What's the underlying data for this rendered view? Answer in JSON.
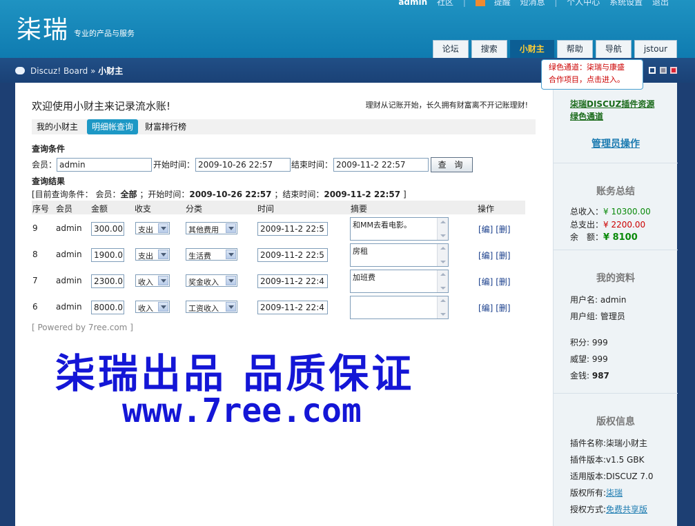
{
  "header": {
    "toplinks": [
      "admin",
      "社区",
      "提醒",
      "短消息",
      "个人中心",
      "系统设置",
      "退出"
    ],
    "logo": "柒瑞",
    "slogan": "专业的产品与服务",
    "nav": [
      "论坛",
      "搜索",
      "小财主",
      "帮助",
      "导航",
      "jstour"
    ]
  },
  "breadcrumb": {
    "site": "Discuz! Board",
    "sep": "»",
    "current": "小财主"
  },
  "bubble": {
    "line1": "绿色通道：柒瑞与康盛",
    "line2": "合作项目，点击进入。"
  },
  "main": {
    "welcome": "欢迎使用小财主来记录流水账!",
    "motto": "理财从记账开始，长久拥有财富离不开记账理财!",
    "tabs": [
      "我的小财主",
      "明细帐查询",
      "财富排行榜"
    ],
    "query": {
      "title": "查询条件",
      "member_label": "会员：",
      "member_value": "admin",
      "start_label": "开始时间：",
      "start_value": "2009-10-26 22:57",
      "end_label": "结束时间：",
      "end_value": "2009-11-2 22:57",
      "button": "查 询"
    },
    "result": {
      "title": "查询结果",
      "cond_prefix": "[目前查询条件： 会员：",
      "cond_member": "全部",
      "cond_start_label": "；开始时间：",
      "cond_start": "2009-10-26 22:57",
      "cond_end_label": "；结束时间：",
      "cond_end": "2009-11-2 22:57",
      "cond_suffix": "]"
    },
    "columns": [
      "序号",
      "会员",
      "金额",
      "收支",
      "分类",
      "时间",
      "摘要",
      "操作"
    ],
    "rows": [
      {
        "no": "9",
        "member": "admin",
        "amount": "300.00",
        "io": "支出",
        "cat": "其他费用",
        "time": "2009-11-2 22:5",
        "memo": "和MM去看电影。",
        "edit": "[编]",
        "del": "[删]"
      },
      {
        "no": "8",
        "member": "admin",
        "amount": "1900.0",
        "io": "支出",
        "cat": "生活费",
        "time": "2009-11-2 22:5",
        "memo": "房租",
        "edit": "[编]",
        "del": "[删]"
      },
      {
        "no": "7",
        "member": "admin",
        "amount": "2300.0",
        "io": "收入",
        "cat": "奖金收入",
        "time": "2009-11-2 22:4",
        "memo": "加班费",
        "edit": "[编]",
        "del": "[删]"
      },
      {
        "no": "6",
        "member": "admin",
        "amount": "8000.0",
        "io": "收入",
        "cat": "工资收入",
        "time": "2009-11-2 22:4",
        "memo": "",
        "edit": "[编]",
        "del": "[删]"
      }
    ],
    "powered": "[ Powered by 7ree.com ]",
    "promo1": "柒瑞出品  品质保证",
    "promo2": "www.7ree.com"
  },
  "sidebar": {
    "link_line1": "柒瑞DISCUZ插件资源",
    "link_line2": "绿色通道",
    "admin_ops": "管理员操作",
    "summary": {
      "title": "账务总结",
      "income_label": "总收入：",
      "income_value": "¥ 10300.00",
      "expense_label": "总支出：",
      "expense_value": "¥ 2200.00",
      "balance_label": "余　额：",
      "balance_value": "¥ 8100"
    },
    "profile": {
      "title": "我的资料",
      "username": "用户名: admin",
      "group": "用户组: 管理员",
      "points": "积分: 999",
      "prestige": "威望: 999",
      "money_label": "金钱: ",
      "money_value": "987"
    },
    "copyright": {
      "title": "版权信息",
      "name": "插件名称:柒瑞小财主",
      "version": "插件版本:v1.5 GBK",
      "compat": "适用版本:DISCUZ 7.0",
      "owner_label": "版权所有:",
      "owner_value": "柒瑞",
      "license_label": "授权方式:",
      "license_value": "免费共享版"
    }
  },
  "colors": {
    "header": "#1f93c2",
    "tab_active": "#0c5e94",
    "promo": "#1416d6",
    "income": "#0a8a0a",
    "expense": "#cc0000"
  }
}
